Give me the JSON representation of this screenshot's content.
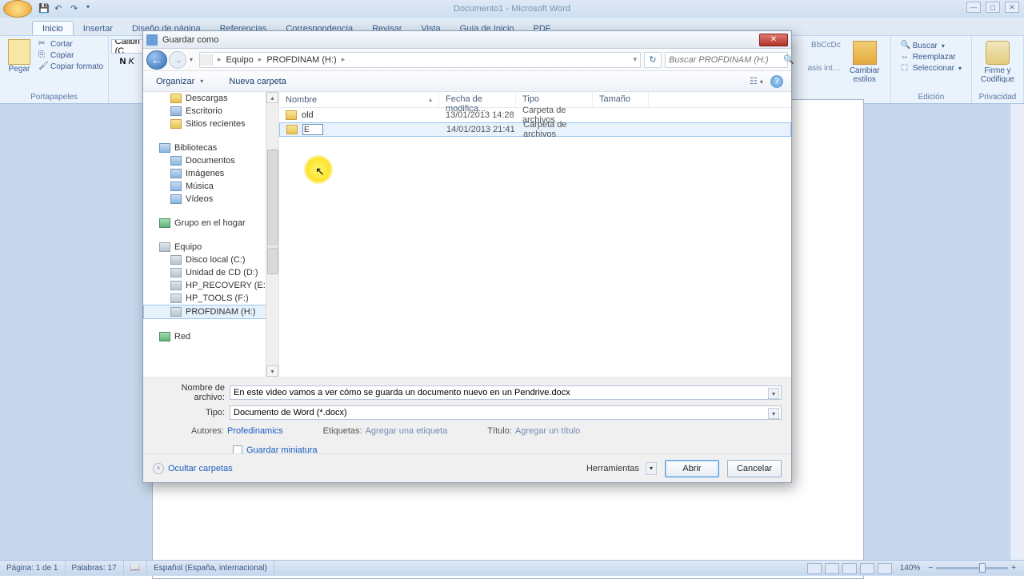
{
  "app": {
    "title": "Documento1 - Microsoft Word"
  },
  "qat": {
    "save": "save-icon",
    "undo": "undo-icon",
    "redo": "redo-icon"
  },
  "ribbon": {
    "tabs": [
      "Inicio",
      "Insertar",
      "Diseño de página",
      "Referencias",
      "Correspondencia",
      "Revisar",
      "Vista",
      "Guía de Inicio",
      "PDF"
    ],
    "active": 0,
    "clipboard": {
      "paste": "Pegar",
      "cut": "Cortar",
      "copy": "Copiar",
      "format": "Copiar formato",
      "group": "Portapapeles"
    },
    "font": {
      "name": "Calibri (C",
      "bold": "N",
      "italic": "K"
    },
    "styles_hint": "BbCcDc",
    "styles_hint2": "asis int…",
    "change_styles": "Cambiar estilos",
    "editing": {
      "find": "Buscar",
      "replace": "Reemplazar",
      "select": "Seleccionar",
      "group": "Edición"
    },
    "privacy": {
      "sign": "Firme y Codifique",
      "group": "Privacidad"
    }
  },
  "dialog": {
    "title": "Guardar como",
    "breadcrumb": [
      "Equipo",
      "PROFDINAM (H:)"
    ],
    "search_placeholder": "Buscar PROFDINAM (H:)",
    "toolbar": {
      "organize": "Organizar",
      "newfolder": "Nueva carpeta"
    },
    "tree": {
      "favorites": [
        "Descargas",
        "Escritorio",
        "Sitios recientes"
      ],
      "libraries_label": "Bibliotecas",
      "libraries": [
        "Documentos",
        "Imágenes",
        "Música",
        "Vídeos"
      ],
      "homegroup": "Grupo en el hogar",
      "computer_label": "Equipo",
      "drives": [
        "Disco local (C:)",
        "Unidad de CD (D:)",
        "HP_RECOVERY (E:)",
        "HP_TOOLS (F:)",
        "PROFDINAM (H:)"
      ],
      "network": "Red"
    },
    "columns": {
      "name": "Nombre",
      "date": "Fecha de modifica...",
      "type": "Tipo",
      "size": "Tamaño"
    },
    "rows": [
      {
        "name": "old",
        "date": "13/01/2013 14:28",
        "type": "Carpeta de archivos",
        "size": ""
      },
      {
        "name": "E",
        "date": "14/01/2013 21:41",
        "type": "Carpeta de archivos",
        "size": "",
        "editing": true
      }
    ],
    "filename_label": "Nombre de archivo:",
    "filename": "En este video vamos a ver cómo se guarda un documento nuevo en un Pendrive.docx",
    "type_label": "Tipo:",
    "type": "Documento de Word (*.docx)",
    "authors_label": "Autores:",
    "authors": "Profedinamics",
    "tags_label": "Etiquetas:",
    "tags_placeholder": "Agregar una etiqueta",
    "title_label": "Título:",
    "title_placeholder": "Agregar un título",
    "thumb": "Guardar miniatura",
    "hide": "Ocultar carpetas",
    "tools": "Herramientas",
    "open": "Abrir",
    "cancel": "Cancelar"
  },
  "status": {
    "page": "Página: 1 de 1",
    "words": "Palabras: 17",
    "lang": "Español (España, internacional)",
    "zoom": "140%"
  }
}
